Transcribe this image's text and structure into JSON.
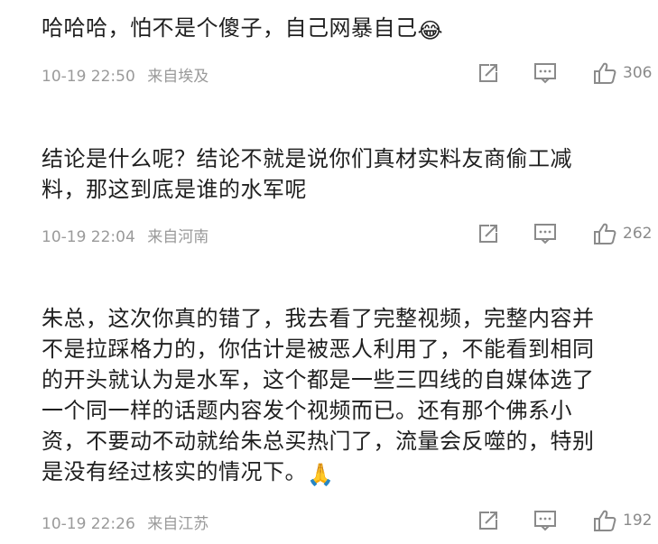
{
  "comments": [
    {
      "text": "哈哈哈，怕不是个傻子，自己网暴自己",
      "emoji": "😂",
      "date": "10-19 22:50",
      "location": "来自埃及",
      "likes": "306"
    },
    {
      "text": "结论是什么呢？结论不就是说你们真材实料友商偷工减\n料，那这到底是谁的水军呢",
      "date": "10-19 22:04",
      "location": "来自河南",
      "likes": "262"
    },
    {
      "text": "朱总，这次你真的错了，我去看了完整视频，完整内容并\n不是拉踩格力的，你估计是被恶人利用了，不能看到相同\n的开头就认为是水军，这个都是一些三四线的自媒体选了\n一个同一样的话题内容发个视频而已。还有那个佛系小\n资，不要动不动就给朱总买热门了，流量会反噬的，特别\n是没有经过核实的情况下。",
      "emoji": "🙏",
      "date": "10-19 22:26",
      "location": "来自江苏",
      "likes": "192"
    }
  ],
  "icons": {
    "share": "share-icon",
    "comment": "comment-icon",
    "like": "thumbs-up-icon"
  },
  "colors": {
    "meta_text": "#9a9a9a",
    "icon": "#8a8a8a"
  }
}
